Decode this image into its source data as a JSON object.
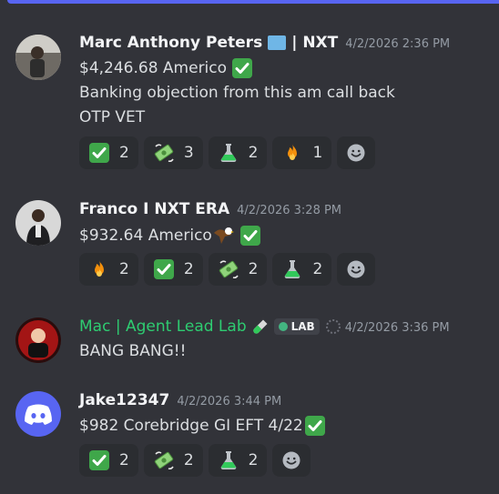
{
  "messages": [
    {
      "author": "Marc Anthony Peters",
      "author_suffix": "| NXT",
      "timestamp": "4/2/2026 2:36 PM",
      "lines": [
        "$4,246.68 Americo",
        "Banking objection from this am call back",
        "OTP VET"
      ],
      "reactions": [
        {
          "emoji": "check-mark",
          "count": "2"
        },
        {
          "emoji": "money-with-wings",
          "count": "3"
        },
        {
          "emoji": "test-tube",
          "count": "2"
        },
        {
          "emoji": "fire",
          "count": "1"
        }
      ]
    },
    {
      "author": "Franco I NXT ERA",
      "timestamp": "4/2/2026 3:28 PM",
      "lines": [
        "$932.64 Americo"
      ],
      "reactions": [
        {
          "emoji": "fire",
          "count": "2"
        },
        {
          "emoji": "check-mark",
          "count": "2"
        },
        {
          "emoji": "money-with-wings",
          "count": "2"
        },
        {
          "emoji": "test-tube",
          "count": "2"
        }
      ]
    },
    {
      "author": "Mac | Agent Lead Lab",
      "tag": "LAB",
      "timestamp": "4/2/2026 3:36 PM",
      "lines": [
        "BANG BANG!!"
      ]
    },
    {
      "author": "Jake12347",
      "timestamp": "4/2/2026 3:44 PM",
      "lines": [
        "$982 Corebridge GI EFT 4/22"
      ],
      "reactions": [
        {
          "emoji": "check-mark",
          "count": "2"
        },
        {
          "emoji": "money-with-wings",
          "count": "2"
        },
        {
          "emoji": "test-tube",
          "count": "2"
        }
      ]
    }
  ],
  "colors": {
    "background": "#323339",
    "reaction_bg": "#2b2d31",
    "accent": "#5865f2",
    "role_green": "#2ecc71"
  }
}
